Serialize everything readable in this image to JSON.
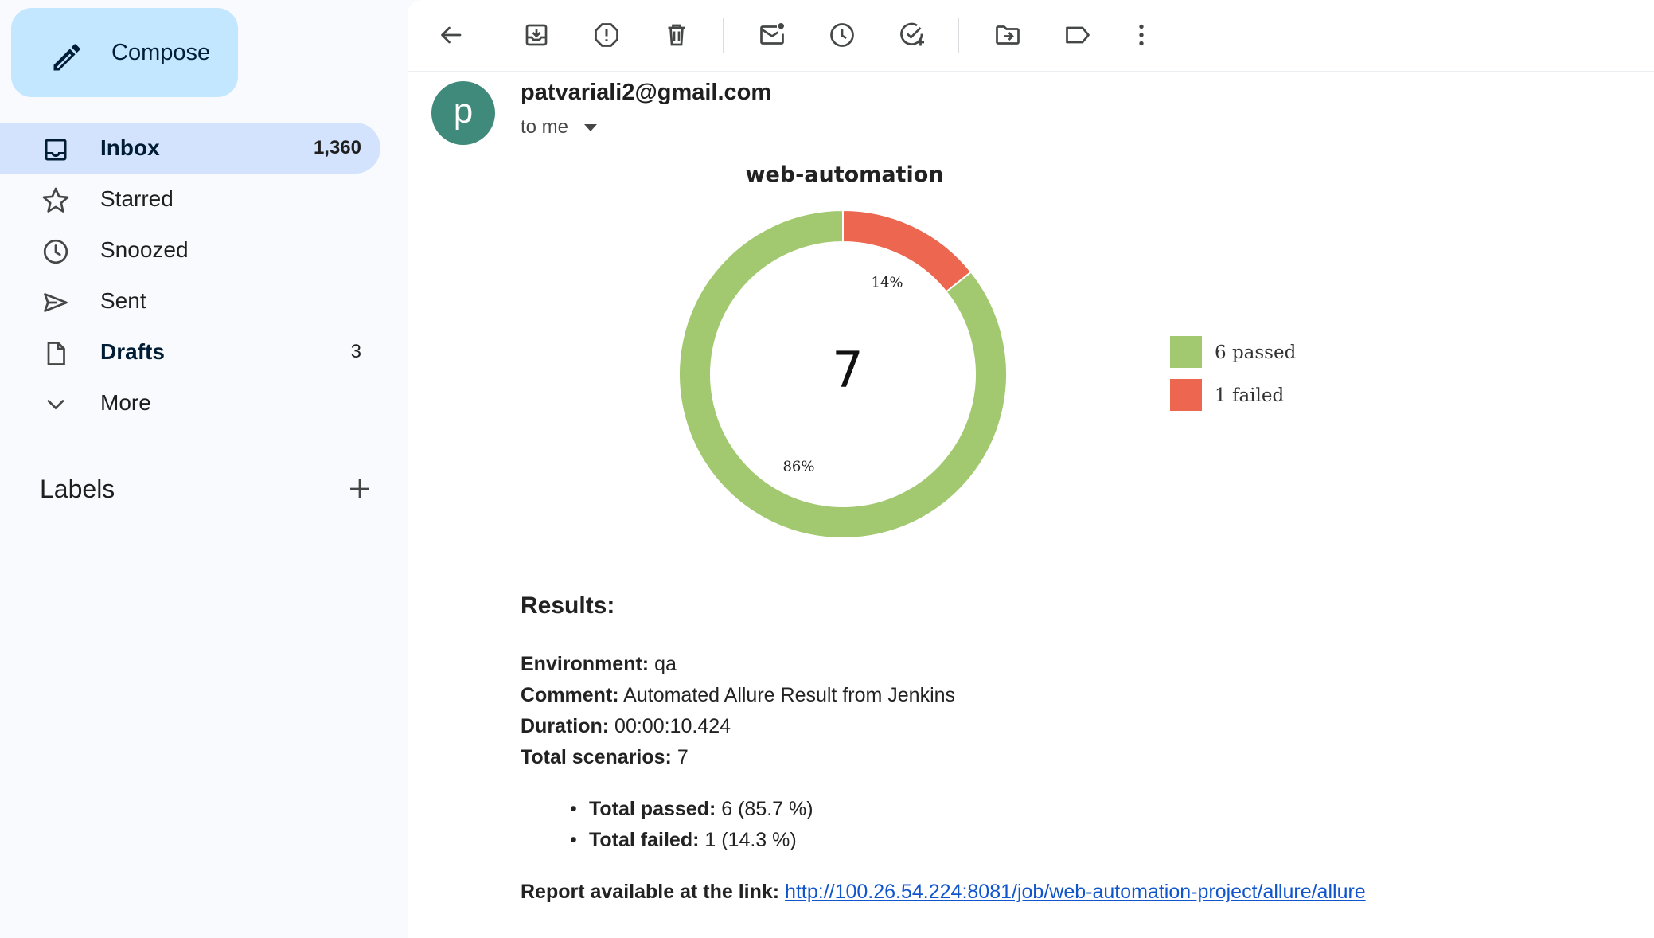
{
  "compose": {
    "label": "Compose",
    "icon": "pencil-icon"
  },
  "nav": [
    {
      "label": "Inbox",
      "count": "1,360",
      "icon": "inbox-icon",
      "active": true
    },
    {
      "label": "Starred",
      "count": "",
      "icon": "star-icon"
    },
    {
      "label": "Snoozed",
      "count": "",
      "icon": "clock-icon"
    },
    {
      "label": "Sent",
      "count": "",
      "icon": "send-icon"
    },
    {
      "label": "Drafts",
      "count": "3",
      "icon": "draft-icon"
    },
    {
      "label": "More",
      "count": "",
      "icon": "chevron-down-icon"
    }
  ],
  "labels": {
    "title": "Labels"
  },
  "toolbar": [
    "back-icon",
    "archive-icon",
    "report-spam-icon",
    "delete-icon",
    "mark-unread-icon",
    "snooze-icon",
    "add-task-icon",
    "move-to-icon",
    "label-icon",
    "more-vert-icon"
  ],
  "message": {
    "avatar_letter": "p",
    "sender": "patvariali2@gmail.com",
    "recipient": "to me"
  },
  "chart_data": {
    "type": "pie",
    "title": "web-automation",
    "center_label": "7",
    "categories": [
      "passed",
      "failed"
    ],
    "values": [
      6,
      1
    ],
    "percent_labels": [
      "86%",
      "14%"
    ],
    "legend": [
      "6 passed",
      "1 failed"
    ],
    "colors": [
      "#a2c96f",
      "#ec6650"
    ],
    "legend_position": "right"
  },
  "results": {
    "heading": "Results:",
    "environment_label": "Environment:",
    "environment_value": " qa",
    "comment_label": "Comment:",
    "comment_value": " Automated Allure Result from Jenkins",
    "duration_label": "Duration:",
    "duration_value": " 00:00:10.424",
    "total_label": "Total scenarios:",
    "total_value": " 7",
    "passed_label": "Total passed:",
    "passed_value": " 6 (85.7 %)",
    "failed_label": "Total failed:",
    "failed_value": " 1 (14.3 %)",
    "report_label": "Report available at the link:",
    "report_link": "http://100.26.54.224:8081/job/web-automation-project/allure/allure"
  }
}
